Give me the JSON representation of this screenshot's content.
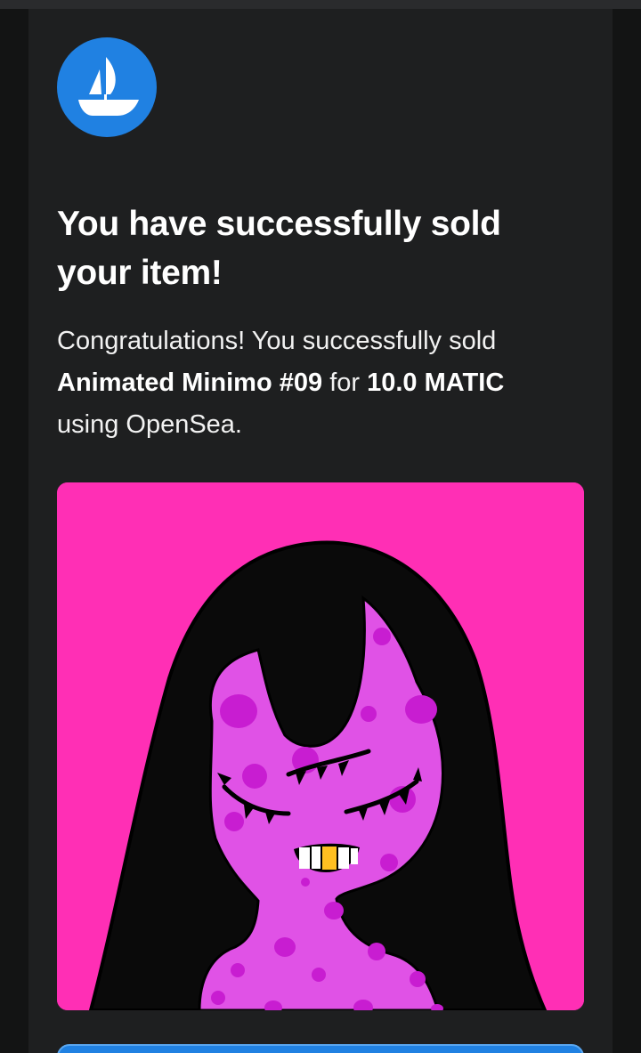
{
  "email": {
    "logo_icon": "opensea-ship-icon",
    "heading": "You have successfully sold your item!",
    "message": {
      "prefix": "Congratulations! You successfully sold",
      "item_name": "Animated Minimo #09",
      "connector": "for",
      "price": "10.0 MATIC",
      "suffix": "using OpenSea."
    },
    "nft_image_icon": "animated-minimo-09-artwork",
    "cta_button_label": ""
  },
  "colors": {
    "page_background": "#131414",
    "card_background": "#1e1f20",
    "brand_blue": "#2081e2",
    "nft_background": "#ff2fb5",
    "character_skin": "#e052e6",
    "character_spots": "#c81dd1",
    "hair": "#0a0a0a"
  }
}
